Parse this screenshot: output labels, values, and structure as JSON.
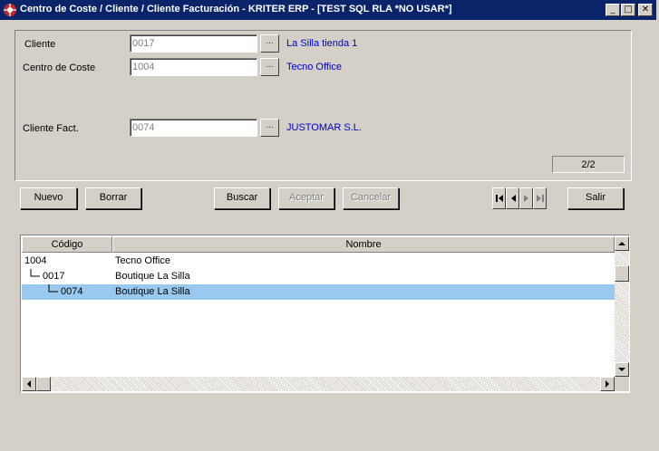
{
  "window": {
    "title": "Centro de Coste / Cliente / Cliente Facturación - KRITER ERP - [TEST SQL RLA *NO USAR*]",
    "minimize_glyph": "_",
    "maximize_glyph": "□",
    "close_glyph": "✕"
  },
  "form": {
    "cliente_label": "Cliente",
    "cliente_value": "0017",
    "cliente_desc": "La Silla tienda 1",
    "centro_label": "Centro de Coste",
    "centro_value": "1004",
    "centro_desc": "Tecno Office",
    "clientefact_label": "Cliente Fact.",
    "clientefact_value": "0074",
    "clientefact_desc": "JUSTOMAR S.L.",
    "lookup_label": "...",
    "record_counter": "2/2"
  },
  "toolbar": {
    "nuevo_label": "Nuevo",
    "borrar_label": "Borrar",
    "buscar_label": "Buscar",
    "aceptar_label": "Aceptar",
    "cancelar_label": "Cancelar",
    "salir_label": "Salir"
  },
  "grid": {
    "columns": [
      "Código",
      "Nombre"
    ],
    "rows": [
      {
        "codigo": "1004",
        "nombre": "Tecno Office",
        "level": 0,
        "selected": false
      },
      {
        "codigo": "0017",
        "nombre": "Boutique La Silla",
        "level": 1,
        "selected": false
      },
      {
        "codigo": "0074",
        "nombre": "Boutique La Silla",
        "level": 2,
        "selected": true
      }
    ]
  },
  "colors": {
    "titlebar": "#0a246a",
    "window_bg": "#d4d0c8",
    "link_text": "#0000cc",
    "selection": "#99c9ef"
  }
}
